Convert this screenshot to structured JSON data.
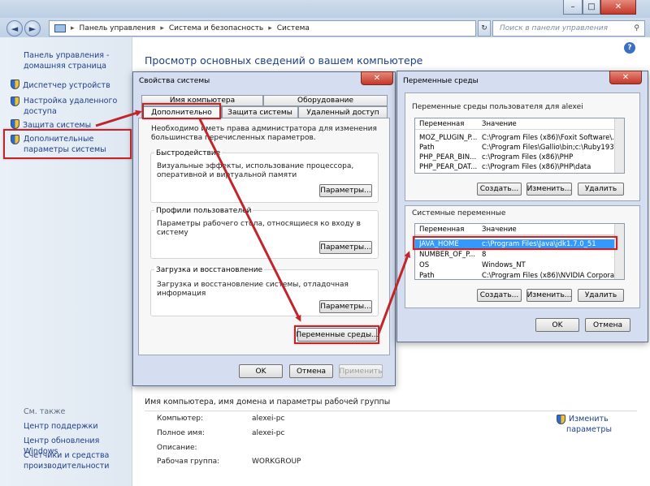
{
  "window": {
    "caption_buttons": [
      "–",
      "□",
      "✕"
    ],
    "nav": {
      "back": "◄",
      "forward": "►"
    },
    "breadcrumb": [
      "Панель управления",
      "Система и безопасность",
      "Система"
    ],
    "search_placeholder": "Поиск в панели управления"
  },
  "sidebar": {
    "home_link": "Панель управления - домашняя страница",
    "items": [
      {
        "label": "Диспетчер устройств",
        "icon": "shield-icon"
      },
      {
        "label": "Настройка удаленного доступа",
        "icon": "shield-icon"
      },
      {
        "label": "Защита системы",
        "icon": "shield-icon"
      },
      {
        "label": "Дополнительные параметры системы",
        "icon": "shield-icon"
      }
    ],
    "see_also": "См. также",
    "see_also_links": [
      "Центр поддержки",
      "Центр обновления Windows",
      "Счетчики и средства производительности"
    ]
  },
  "main": {
    "heading": "Просмотр основных сведений о вашем компьютере",
    "help": "?",
    "computer_section_title": "Имя компьютера, имя домена и параметры рабочей группы",
    "change_link": "Изменить параметры",
    "info_rows": [
      {
        "label": "Компьютер:",
        "value": "alexei-pc"
      },
      {
        "label": "Полное имя:",
        "value": "alexei-pc"
      },
      {
        "label": "Описание:",
        "value": ""
      },
      {
        "label": "Рабочая группа:",
        "value": "WORKGROUP"
      }
    ]
  },
  "sysprops": {
    "title": "Свойства системы",
    "close": "✕",
    "tabs_top": [
      "Имя компьютера",
      "Оборудование"
    ],
    "tabs_bottom": [
      "Дополнительно",
      "Защита системы",
      "Удаленный доступ"
    ],
    "note": "Необходимо иметь права администратора для изменения большинства перечисленных параметров.",
    "groups": [
      {
        "title": "Быстродействие",
        "text": "Визуальные эффекты, использование процессора, оперативной и виртуальной памяти",
        "button": "Параметры..."
      },
      {
        "title": "Профили пользователей",
        "text": "Параметры рабочего стола, относящиеся ко входу в систему",
        "button": "Параметры..."
      },
      {
        "title": "Загрузка и восстановление",
        "text": "Загрузка и восстановление системы, отладочная информация",
        "button": "Параметры..."
      }
    ],
    "env_button": "Переменные среды...",
    "ok": "OK",
    "cancel": "Отмена",
    "apply": "Применить"
  },
  "envvars": {
    "title": "Переменные среды",
    "close": "✕",
    "user_section": "Переменные среды пользователя для alexei",
    "col_var": "Переменная",
    "col_val": "Значение",
    "user_rows": [
      {
        "name": "MOZ_PLUGIN_P...",
        "value": "C:\\Program Files (x86)\\Foxit Software\\..."
      },
      {
        "name": "Path",
        "value": "C:\\Program Files\\Gallio\\bin;c:\\Ruby193\\..."
      },
      {
        "name": "PHP_PEAR_BIN...",
        "value": "c:\\Program Files (x86)\\PHP"
      },
      {
        "name": "PHP_PEAR_DAT...",
        "value": "c:\\Program Files (x86)\\PHP\\data"
      }
    ],
    "system_section": "Системные переменные",
    "system_rows": [
      {
        "name": "JAVA_HOME",
        "value": "c:\\Program Files\\Java\\jdk1.7.0_51",
        "selected": true
      },
      {
        "name": "NUMBER_OF_P...",
        "value": "8"
      },
      {
        "name": "OS",
        "value": "Windows_NT"
      },
      {
        "name": "Path",
        "value": "C:\\Program Files (x86)\\NVIDIA Corpora..."
      }
    ],
    "create": "Создать...",
    "edit": "Изменить...",
    "delete": "Удалить",
    "ok": "OK",
    "cancel": "Отмена"
  },
  "colors": {
    "annotation_red": "#c0252a",
    "link_blue": "#1e3f8a",
    "selection_blue": "#3399ff"
  }
}
